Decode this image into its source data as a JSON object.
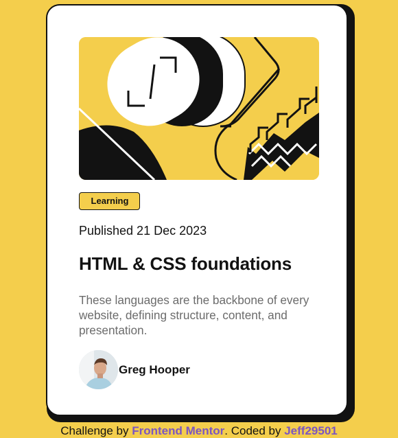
{
  "card": {
    "tag": "Learning",
    "published": "Published 21 Dec 2023",
    "title": "HTML & CSS foundations",
    "description": "These languages are the backbone of every website, defining structure, content, and presentation.",
    "author": {
      "name": "Greg Hooper",
      "avatar_icon": "person-portrait-icon"
    },
    "illustration_icon": "abstract-illustration-icon"
  },
  "attribution": {
    "prefix": "Challenge by ",
    "challenge_link": "Frontend Mentor",
    "middle": ". Coded by ",
    "author_link": "Jeff29501"
  },
  "colors": {
    "background": "#F4CE4C",
    "card": "#FFFFFF",
    "ink": "#121212",
    "muted": "#6B6B6B",
    "link": "#7B56C2"
  }
}
